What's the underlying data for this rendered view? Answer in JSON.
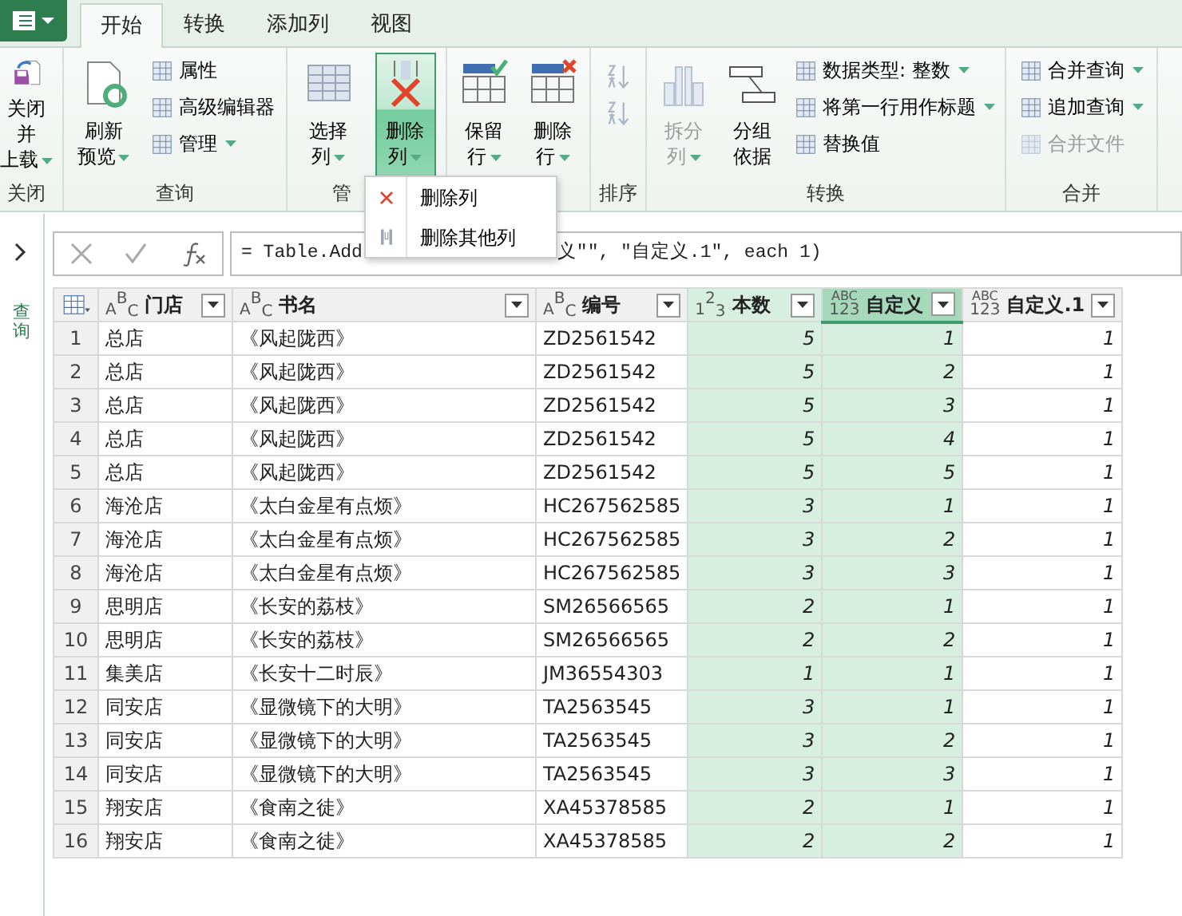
{
  "tabs": [
    {
      "label": "开始",
      "selected": true
    },
    {
      "label": "转换",
      "selected": false
    },
    {
      "label": "添加列",
      "selected": false
    },
    {
      "label": "视图",
      "selected": false
    }
  ],
  "ribbon_groups": [
    {
      "label": "关闭",
      "items": [
        {
          "kind": "large",
          "lines": [
            "关闭并",
            "上载"
          ],
          "dropdown": true,
          "pressed": false,
          "disabled": false
        }
      ]
    },
    {
      "label": "查询",
      "items": [
        {
          "kind": "large",
          "lines": [
            "刷新",
            "预览"
          ],
          "dropdown": true,
          "pressed": false,
          "disabled": false
        },
        {
          "kind": "stack",
          "entries": [
            {
              "label": "属性",
              "dropdown": false,
              "disabled": false
            },
            {
              "label": "高级编辑器",
              "dropdown": false,
              "disabled": false
            },
            {
              "label": "管理",
              "dropdown": true,
              "disabled": false
            }
          ]
        }
      ]
    },
    {
      "label": "管",
      "items": [
        {
          "kind": "large",
          "lines": [
            "选择",
            "列"
          ],
          "dropdown": true,
          "pressed": false,
          "disabled": false
        },
        {
          "kind": "large",
          "lines": [
            "删除",
            "列"
          ],
          "dropdown": true,
          "pressed": true,
          "disabled": false
        }
      ]
    },
    {
      "items": [
        {
          "kind": "large",
          "lines": [
            "保留",
            "行"
          ],
          "dropdown": true,
          "pressed": false,
          "disabled": false
        },
        {
          "kind": "large",
          "lines": [
            "删除",
            "行"
          ],
          "dropdown": true,
          "pressed": false,
          "disabled": false
        }
      ]
    },
    {
      "label": "排序",
      "items": [
        {
          "kind": "iconstack",
          "disabled": true
        }
      ]
    },
    {
      "label": "转换",
      "items": [
        {
          "kind": "large",
          "lines": [
            "拆分",
            "列"
          ],
          "dropdown": true,
          "pressed": false,
          "disabled": true
        },
        {
          "kind": "large",
          "lines": [
            "分组",
            "依据"
          ],
          "dropdown": false,
          "pressed": false,
          "disabled": false
        },
        {
          "kind": "stack",
          "entries": [
            {
              "label": "数据类型: 整数",
              "dropdown": true,
              "disabled": false
            },
            {
              "label": "将第一行用作标题",
              "dropdown": true,
              "disabled": false
            },
            {
              "label": "替换值",
              "dropdown": false,
              "disabled": false
            }
          ]
        }
      ]
    },
    {
      "label": "合并",
      "items": [
        {
          "kind": "stack",
          "entries": [
            {
              "label": "合并查询",
              "dropdown": true,
              "disabled": false
            },
            {
              "label": "追加查询",
              "dropdown": true,
              "disabled": false
            },
            {
              "label": "合并文件",
              "dropdown": false,
              "disabled": true
            }
          ]
        }
      ]
    }
  ],
  "dropdown_menu": [
    {
      "label": "删除列"
    },
    {
      "label": "删除其他列"
    }
  ],
  "side_panel": {
    "label": "查询"
  },
  "formula_bar": {
    "formula_start": "= Table.Add",
    "formula_end": "义\"\", \"自定义.1\", each 1)"
  },
  "table": {
    "columns": [
      {
        "name": "门店",
        "kind": "text",
        "type_label": [
          "A",
          "B",
          "C"
        ],
        "selected": false,
        "focused": false
      },
      {
        "name": "书名",
        "kind": "text",
        "type_label": [
          "A",
          "B",
          "C"
        ],
        "selected": false,
        "focused": false
      },
      {
        "name": "编号",
        "kind": "text",
        "type_label": [
          "A",
          "B",
          "C"
        ],
        "selected": false,
        "focused": false
      },
      {
        "name": "本数",
        "kind": "number",
        "type_label": [
          "1",
          "2",
          "3"
        ],
        "selected": true,
        "focused": false
      },
      {
        "name": "自定义",
        "kind": "any",
        "type_label": [
          "ABC",
          "123"
        ],
        "selected": true,
        "focused": true
      },
      {
        "name": "自定义.1",
        "kind": "any",
        "type_label": [
          "ABC",
          "123"
        ],
        "selected": false,
        "focused": false
      }
    ],
    "rows": [
      {
        "number": "1",
        "cells": [
          "总店",
          "《风起陇西》",
          "ZD2561542",
          "5",
          "1",
          "1"
        ]
      },
      {
        "number": "2",
        "cells": [
          "总店",
          "《风起陇西》",
          "ZD2561542",
          "5",
          "2",
          "1"
        ]
      },
      {
        "number": "3",
        "cells": [
          "总店",
          "《风起陇西》",
          "ZD2561542",
          "5",
          "3",
          "1"
        ]
      },
      {
        "number": "4",
        "cells": [
          "总店",
          "《风起陇西》",
          "ZD2561542",
          "5",
          "4",
          "1"
        ]
      },
      {
        "number": "5",
        "cells": [
          "总店",
          "《风起陇西》",
          "ZD2561542",
          "5",
          "5",
          "1"
        ]
      },
      {
        "number": "6",
        "cells": [
          "海沧店",
          "《太白金星有点烦》",
          "HC267562585",
          "3",
          "1",
          "1"
        ]
      },
      {
        "number": "7",
        "cells": [
          "海沧店",
          "《太白金星有点烦》",
          "HC267562585",
          "3",
          "2",
          "1"
        ]
      },
      {
        "number": "8",
        "cells": [
          "海沧店",
          "《太白金星有点烦》",
          "HC267562585",
          "3",
          "3",
          "1"
        ]
      },
      {
        "number": "9",
        "cells": [
          "思明店",
          "《长安的荔枝》",
          "SM26566565",
          "2",
          "1",
          "1"
        ]
      },
      {
        "number": "10",
        "cells": [
          "思明店",
          "《长安的荔枝》",
          "SM26566565",
          "2",
          "2",
          "1"
        ]
      },
      {
        "number": "11",
        "cells": [
          "集美店",
          "《长安十二时辰》",
          "JM36554303",
          "1",
          "1",
          "1"
        ]
      },
      {
        "number": "12",
        "cells": [
          "同安店",
          "《显微镜下的大明》",
          "TA2563545",
          "3",
          "1",
          "1"
        ]
      },
      {
        "number": "13",
        "cells": [
          "同安店",
          "《显微镜下的大明》",
          "TA2563545",
          "3",
          "2",
          "1"
        ]
      },
      {
        "number": "14",
        "cells": [
          "同安店",
          "《显微镜下的大明》",
          "TA2563545",
          "3",
          "3",
          "1"
        ]
      },
      {
        "number": "15",
        "cells": [
          "翔安店",
          "《食南之徒》",
          "XA45378585",
          "2",
          "1",
          "1"
        ]
      },
      {
        "number": "16",
        "cells": [
          "翔安店",
          "《食南之徒》",
          "XA45378585",
          "2",
          "2",
          "1"
        ]
      }
    ]
  }
}
